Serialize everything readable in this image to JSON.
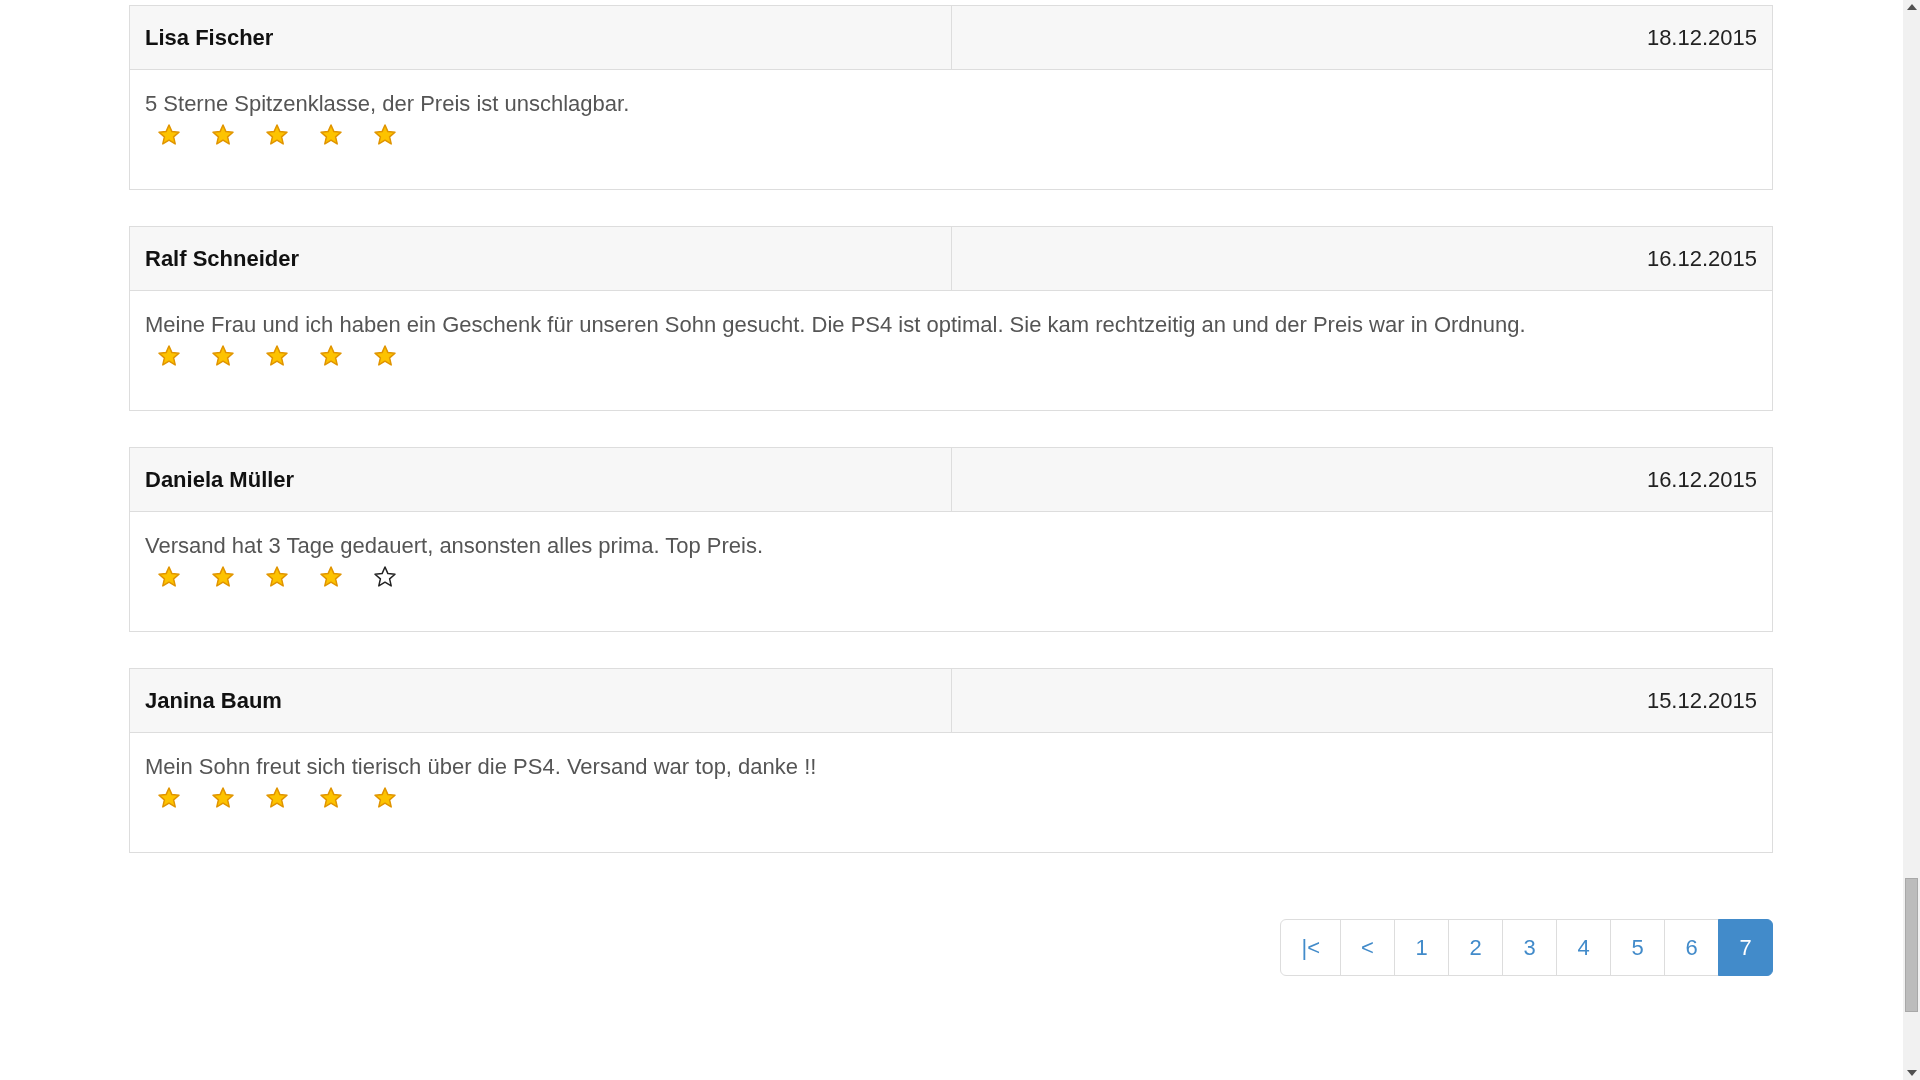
{
  "reviews": [
    {
      "name": "Lisa Fischer",
      "date": "18.12.2015",
      "text": "5 Sterne Spitzenklasse, der Preis ist unschlagbar.",
      "stars": 5
    },
    {
      "name": "Ralf Schneider",
      "date": "16.12.2015",
      "text": "Meine Frau und ich haben ein Geschenk für unseren Sohn gesucht. Die PS4 ist optimal. Sie kam rechtzeitig an und der Preis war in Ordnung.",
      "stars": 5
    },
    {
      "name": "Daniela Müller",
      "date": "16.12.2015",
      "text": "Versand hat 3 Tage gedauert, ansonsten alles prima. Top Preis.",
      "stars": 4
    },
    {
      "name": "Janina Baum",
      "date": "15.12.2015",
      "text": "Mein Sohn freut sich tierisch über die PS4. Versand war top, danke !!",
      "stars": 5
    }
  ],
  "pagination": [
    {
      "label": "|<",
      "selected": false
    },
    {
      "label": "<",
      "selected": false
    },
    {
      "label": "1",
      "selected": false
    },
    {
      "label": "2",
      "selected": false
    },
    {
      "label": "3",
      "selected": false
    },
    {
      "label": "4",
      "selected": false
    },
    {
      "label": "5",
      "selected": false
    },
    {
      "label": "6",
      "selected": false
    },
    {
      "label": "7",
      "selected": true
    }
  ]
}
